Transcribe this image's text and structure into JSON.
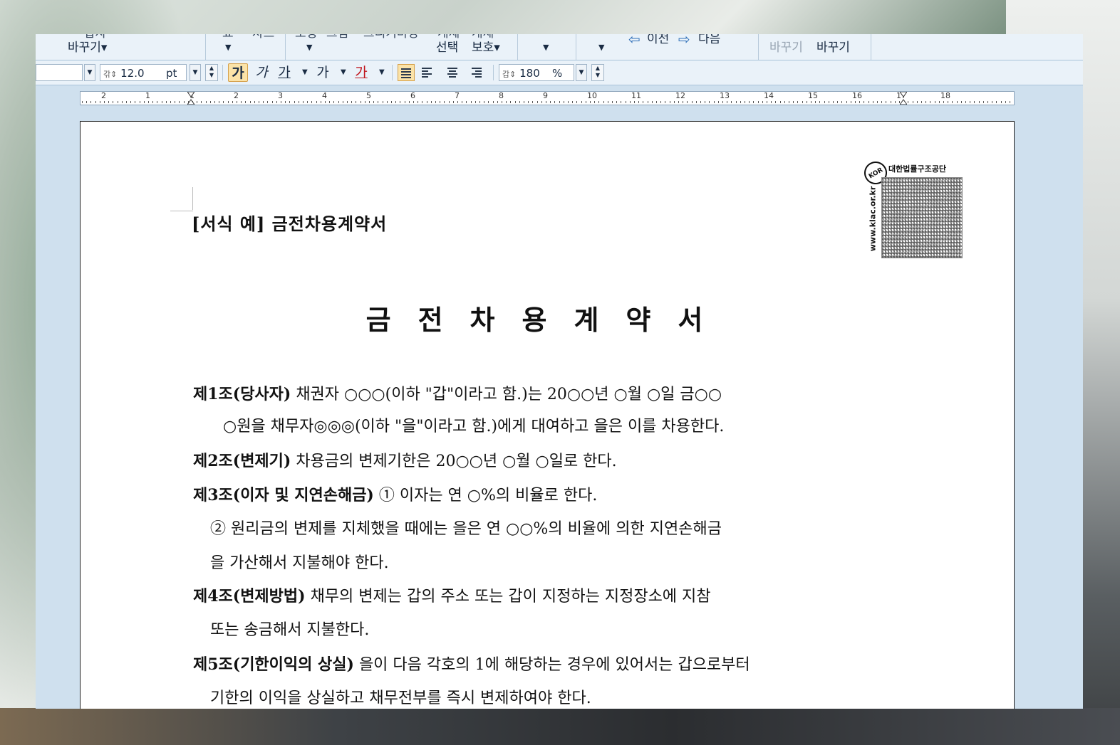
{
  "toolbar_top": {
    "cut_labels": [
      "삽자",
      "표",
      "차트",
      "도형",
      "그림",
      "그리기마당",
      "개체",
      "개체"
    ],
    "replace_label": "바꾸기▾",
    "select_label": "선택",
    "protect_label": "보호▾",
    "prev_label": "이전",
    "next_label": "다음",
    "replace_disabled": "바꾸기",
    "find_replace": "바꾸기"
  },
  "toolbar_format": {
    "font_size": "12.0",
    "font_size_unit": "pt",
    "bold": "가",
    "italic": "가",
    "underline": "가",
    "strike": "가",
    "color": "가",
    "line_spacing": "180",
    "line_spacing_unit": "%"
  },
  "ruler": {
    "labels": [
      "2",
      "1",
      "1",
      "2",
      "3",
      "4",
      "5",
      "6",
      "7",
      "8",
      "9",
      "10",
      "11",
      "12",
      "13",
      "14",
      "15",
      "16",
      "17",
      "18"
    ]
  },
  "stamp": {
    "org": "대한법률구조공단",
    "url": "www.klac.or.kr",
    "badge": "KOR"
  },
  "document": {
    "form_label": "[서식 예] 금전차용계약서",
    "title": "금전차용계약서",
    "clauses": [
      {
        "head": "제1조(당사자)",
        "text": " 채권자 ○○○(이하 \"갑\"이라고 함.)는 20○○년 ○월 ○일 금○○",
        "cont": "○원을 채무자◎◎◎(이하 \"을\"이라고 함.)에게 대여하고 을은 이를 차용한다."
      },
      {
        "head": "제2조(변제기)",
        "text": " 차용금의 변제기한은 20○○년 ○월 ○일로 한다."
      },
      {
        "head": "제3조(이자 및 지연손해금)",
        "text": "  ① 이자는 연 ○%의 비율로 한다.",
        "cont1": "② 원리금의 변제를 지체했을 때에는 을은 연 ○○%의 비율에 의한 지연손해금",
        "cont2": "을 가산해서 지불해야 한다."
      },
      {
        "head": "제4조(변제방법)",
        "text": " 채무의 변제는 갑의 주소 또는 갑이 지정하는 지정장소에 지참",
        "cont": "또는 송금해서 지불한다."
      },
      {
        "head": "제5조(기한이익의 상실)",
        "text": "  을이 다음 각호의 1에 해당하는 경우에 있어서는 갑으로부터",
        "cont": "기한의 이익을 상실하고 채무전부를 즉시 변제하여야 한다."
      }
    ]
  }
}
